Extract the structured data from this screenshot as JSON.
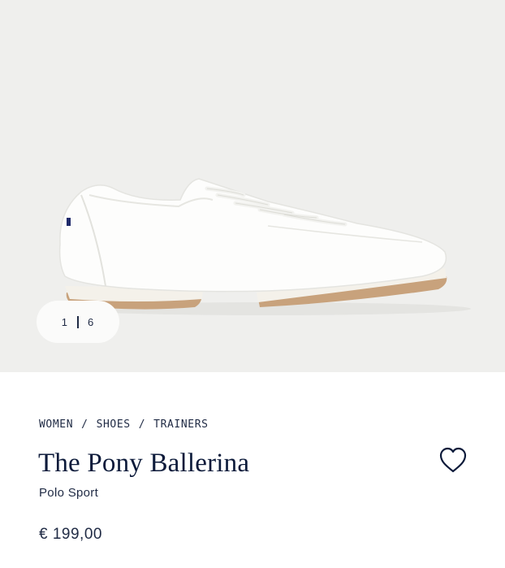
{
  "gallery": {
    "current": "1",
    "total": "6"
  },
  "breadcrumb": [
    {
      "label": "WOMEN"
    },
    {
      "label": "SHOES"
    },
    {
      "label": "TRAINERS"
    }
  ],
  "breadcrumb_separator": "/",
  "product": {
    "title": "The Pony Ballerina",
    "brand": "Polo Sport",
    "price": "€ 199,00"
  },
  "colors": {
    "navy": "#0c1a3a",
    "hero_background": "#efefed",
    "sole": "#c8a27c"
  },
  "icons": {
    "wishlist": "heart-outline-icon"
  }
}
